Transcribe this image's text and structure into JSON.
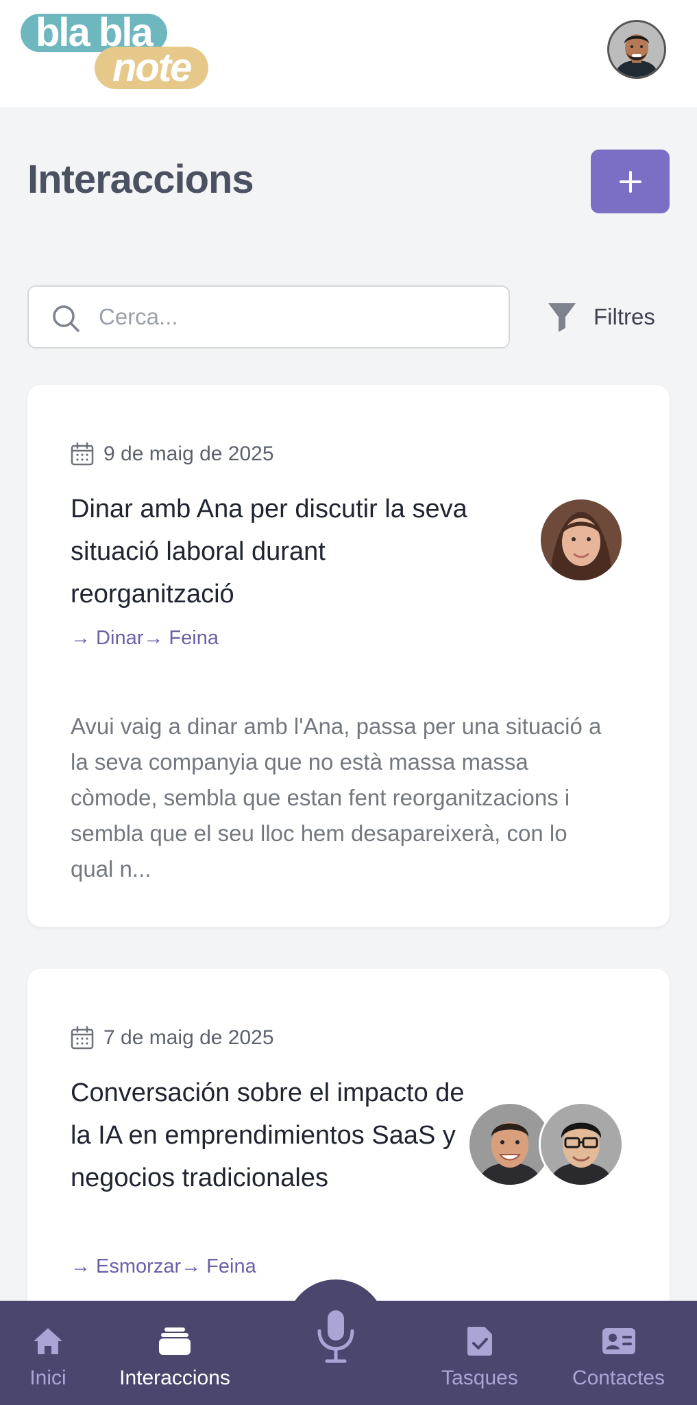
{
  "header": {
    "logo_top": "bla bla",
    "logo_bottom": "note"
  },
  "main": {
    "title": "Interaccions",
    "add_icon": "plus-icon",
    "search": {
      "placeholder": "Cerca...",
      "icon": "search-icon"
    },
    "filter": {
      "label": "Filtres",
      "icon": "funnel-icon"
    }
  },
  "interactions": [
    {
      "date": "9 de maig de 2025",
      "title": "Dinar amb Ana per discutir la seva situació laboral durant reorganització",
      "tags": "→ Dinar→ Feina",
      "preview": "Avui vaig a dinar amb l'Ana, passa per una situació a la seva companyia que no està massa massa còmode, sembla que estan fent reorganitzacions i sembla que el seu lloc hem desapareixerà, con lo qual n..."
    },
    {
      "date": "7 de maig de 2025",
      "title": "Conversación sobre el impacto de la IA en emprendimientos SaaS y negocios tradicionales",
      "tags": "→ Esmorzar→ Feina"
    }
  ],
  "nav": {
    "items": [
      {
        "label": "Inici",
        "icon": "home-icon"
      },
      {
        "label": "Interaccions",
        "icon": "stack-icon"
      },
      {
        "label": "",
        "icon": "microphone-icon"
      },
      {
        "label": "Tasques",
        "icon": "checklist-icon"
      },
      {
        "label": "Contactes",
        "icon": "contact-card-icon"
      }
    ],
    "active": "Interaccions"
  },
  "colors": {
    "accent": "#7a6fc4",
    "nav_background": "#4a466d",
    "tag": "#6b5fa8",
    "logo_teal": "#6fb7bf",
    "logo_gold": "#e6c98a"
  }
}
